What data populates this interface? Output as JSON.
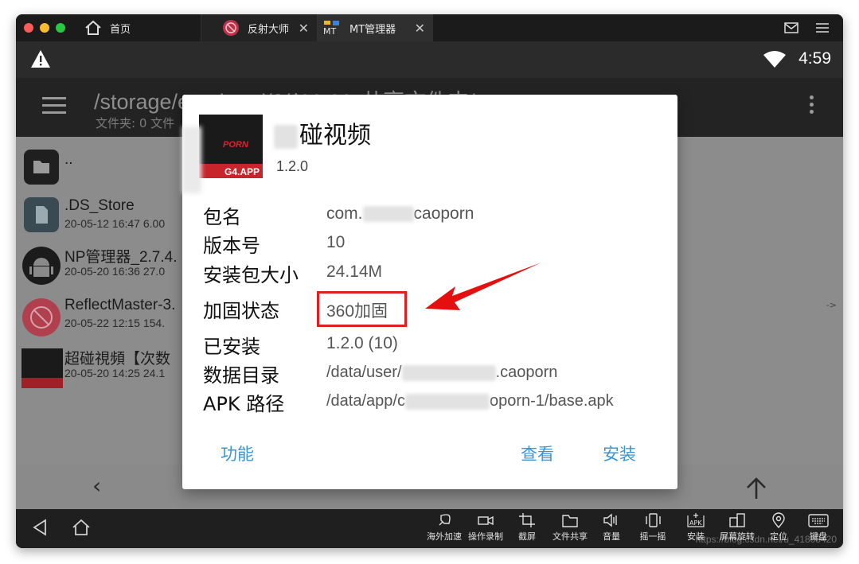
{
  "host": {
    "tabs": [
      {
        "label": "首页"
      },
      {
        "label": "反射大师"
      },
      {
        "label": "MT管理器"
      }
    ]
  },
  "android": {
    "time": "4:59",
    "path": "/storage/emulated/0/$MuMu共享文件夹/",
    "path_sub": "文件夹: 0  文件",
    "files": [
      {
        "name": "..",
        "meta": ""
      },
      {
        "name": ".DS_Store",
        "meta": "20-05-12 16:47  6.00"
      },
      {
        "name": "NP管理器_2.7.4.",
        "meta": "20-05-20 16:36  27.0"
      },
      {
        "name": "ReflectMaster-3.",
        "meta": "20-05-22 12:15  154."
      },
      {
        "name": "超碰視頻【次数",
        "meta": "20-05-20 14:25  24.1"
      }
    ],
    "side_arrow": "->"
  },
  "dialog": {
    "app_icon_text": "G4.APP",
    "app_icon_logo": "PORN",
    "app_name": "碰视频",
    "app_version": "1.2.0",
    "rows": [
      {
        "label": "包名",
        "value_prefix": "com.",
        "value_suffix": "caoporn"
      },
      {
        "label": "版本号",
        "value": "10"
      },
      {
        "label": "安装包大小",
        "value": "24.14M"
      },
      {
        "label": "加固状态",
        "value": "360加固"
      },
      {
        "label": "已安装",
        "value": "1.2.0 (10)"
      },
      {
        "label": "数据目录",
        "value_prefix": "/data/user/",
        "value_suffix": ".caoporn"
      },
      {
        "label": "APK 路径",
        "value_prefix": "/data/app/c",
        "value_suffix": "oporn-1/base.apk"
      }
    ],
    "buttons": {
      "function": "功能",
      "view": "查看",
      "install": "安装"
    }
  },
  "toolbar": {
    "tools": [
      {
        "label": "海外加速"
      },
      {
        "label": "操作录制"
      },
      {
        "label": "截屏"
      },
      {
        "label": "文件共享"
      },
      {
        "label": "音量"
      },
      {
        "label": "摇一摇"
      },
      {
        "label": "安装"
      },
      {
        "label": "屏幕旋转"
      },
      {
        "label": "定位"
      },
      {
        "label": "键盘"
      }
    ],
    "watermark": "https://blog.csdn.net/u_41808420"
  }
}
